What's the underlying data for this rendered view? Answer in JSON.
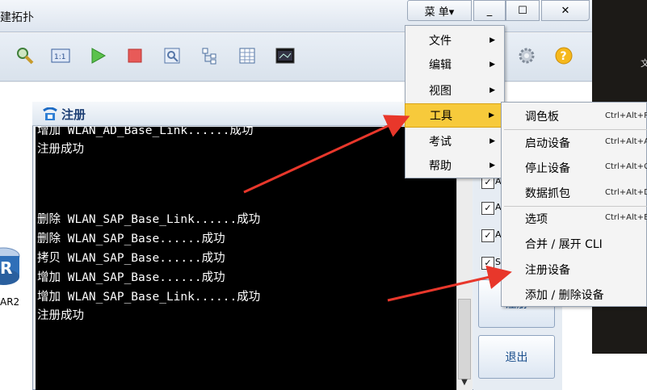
{
  "window": {
    "title": "建拓扑",
    "menu_label": "菜 单▾",
    "minimize": "_",
    "maximize": "☐",
    "close": "✕"
  },
  "toolbar": {
    "icons": [
      "search-icon",
      "topology-icon",
      "play-icon",
      "stop-icon",
      "capture-icon",
      "tree-icon",
      "table-icon",
      "terminal-icon",
      "gear-icon",
      "help-icon"
    ]
  },
  "workspace": {
    "router_label": "AR2",
    "right_text": "文"
  },
  "register": {
    "title": "注册",
    "console_lines": [
      "增加 WLAN_AD_Base_Link......成功",
      "注册成功",
      "",
      "",
      "",
      "删除 WLAN_SAP_Base_Link......成功",
      "删除 WLAN_SAP_Base......成功",
      "拷贝 WLAN_SAP_Base......成功",
      "增加 WLAN_SAP_Base......成功",
      "增加 WLAN_SAP_Base_Link......成功",
      "注册成功"
    ],
    "checkboxes": [
      {
        "label": "A",
        "checked": true
      },
      {
        "label": "A",
        "checked": true
      },
      {
        "label": "A",
        "checked": true
      },
      {
        "label": "S",
        "checked": true
      }
    ],
    "register_button": "注册",
    "exit_button": "退出"
  },
  "menu": {
    "items": [
      {
        "label": "文件",
        "arrow": "▶"
      },
      {
        "label": "编辑",
        "arrow": "▶"
      },
      {
        "label": "视图",
        "arrow": "▶"
      },
      {
        "label": "工具",
        "arrow": "▶"
      },
      {
        "label": "考试",
        "arrow": "▶"
      },
      {
        "label": "帮助",
        "arrow": "▶"
      }
    ]
  },
  "submenu": {
    "items": [
      {
        "label": "调色板",
        "shortcut": "Ctrl+Alt+P"
      },
      {
        "label": "启动设备",
        "shortcut": "Ctrl+Alt+A"
      },
      {
        "label": "停止设备",
        "shortcut": "Ctrl+Alt+C"
      },
      {
        "label": "数据抓包",
        "shortcut": "Ctrl+Alt+D"
      },
      {
        "label": "选项",
        "shortcut": "Ctrl+Alt+E"
      },
      {
        "label": "合并 / 展开 CLI",
        "shortcut": ""
      },
      {
        "label": "注册设备",
        "shortcut": ""
      },
      {
        "label": "添加 / 删除设备",
        "shortcut": ""
      }
    ]
  },
  "colors": {
    "highlight": "#f7ca3b",
    "arrow": "#e8372b",
    "console_bg": "#000000",
    "button_text": "#1b4f8c"
  }
}
